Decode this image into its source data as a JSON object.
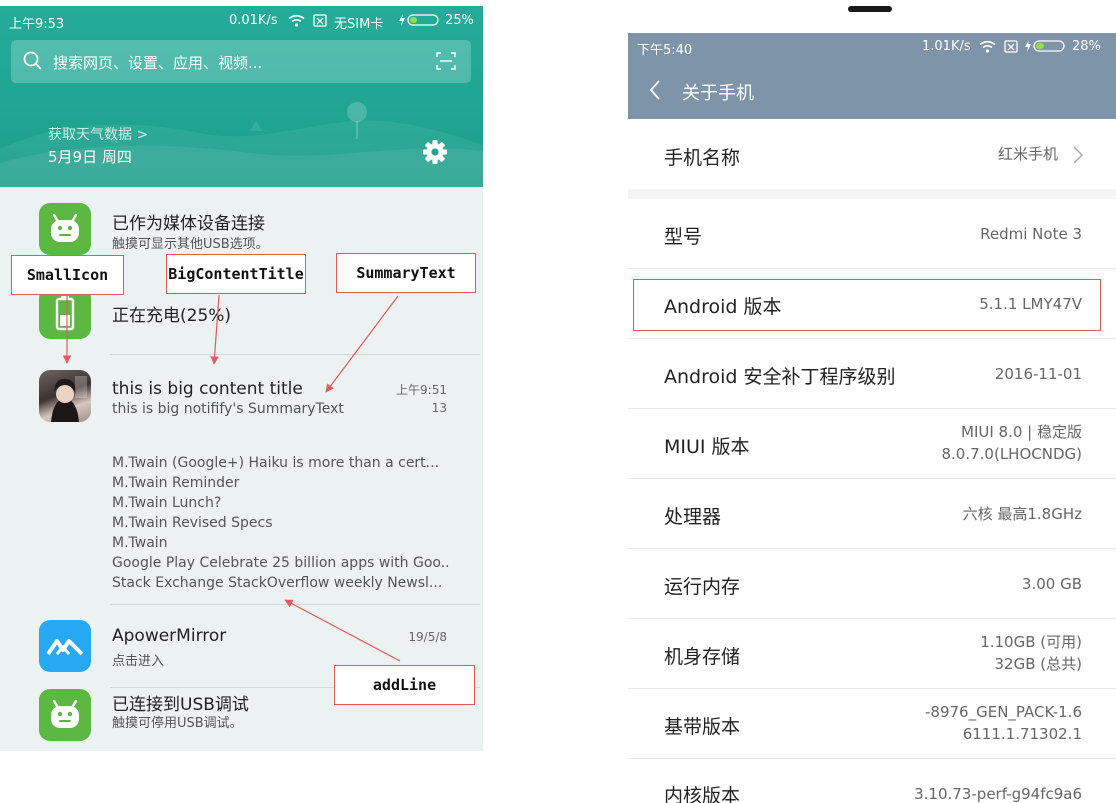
{
  "left_phone": {
    "status_bar": {
      "time": "上午9:53",
      "speed": "0.01K/s",
      "sim": "无SIM卡",
      "battery": "25%"
    },
    "search": {
      "placeholder": "搜索网页、设置、应用、视频..."
    },
    "weather": {
      "link": "获取天气数据 >",
      "date": "5月9日 周四"
    },
    "notifications": [
      {
        "title": "已作为媒体设备连接",
        "subtitle": "触摸可显示其他USB选项。",
        "icon": "android-robot-icon"
      },
      {
        "title": "正在充电(25%)",
        "icon": "battery-icon"
      },
      {
        "title": "this is big content title",
        "subtitle": "this is big notifify's SummaryText",
        "time": "上午9:51",
        "count": "13",
        "icon": "avatar-photo",
        "lines": [
          "M.Twain (Google+) Haiku is more than a cert...",
          "M.Twain Reminder",
          "M.Twain Lunch?",
          "M.Twain Revised Specs",
          "M.Twain",
          "Google Play Celebrate 25 billion apps with Goo..",
          "Stack Exchange StackOverflow weekly Newsl..."
        ]
      },
      {
        "title": "ApowerMirror",
        "subtitle": "点击进入",
        "time": "19/5/8",
        "icon": "apowermirror-icon"
      },
      {
        "title": "已连接到USB调试",
        "subtitle": "触摸可停用USB调试。",
        "icon": "android-robot-icon"
      }
    ],
    "annotations": [
      "SmallIcon",
      "BigContentTitle",
      "SummaryText",
      "addLine"
    ]
  },
  "right_phone": {
    "status_bar": {
      "time": "下午5:40",
      "speed": "1.01K/s",
      "battery": "28%"
    },
    "header": {
      "title": "关于手机"
    },
    "rows": [
      {
        "label": "手机名称",
        "value": "红米手机"
      },
      {
        "label": "型号",
        "value": "Redmi Note 3"
      },
      {
        "label": "Android 版本",
        "value": "5.1.1 LMY47V"
      },
      {
        "label": "Android 安全补丁程序级别",
        "value": "2016-11-01"
      },
      {
        "label": "MIUI 版本",
        "value": "MIUI 8.0 | 稳定版",
        "value2": "8.0.7.0(LHOCNDG)"
      },
      {
        "label": "处理器",
        "value": "六核 最高1.8GHz"
      },
      {
        "label": "运行内存",
        "value": "3.00 GB"
      },
      {
        "label": "机身存储",
        "value": "1.10GB (可用)",
        "value2": "32GB (总共)"
      },
      {
        "label": "基带版本",
        "value": "-8976_GEN_PACK-1.6",
        "value2": "6111.1.71302.1"
      },
      {
        "label": "内核版本",
        "value": "3.10.73-perf-g94fc9a6"
      }
    ]
  },
  "colors": {
    "teal": "#1fa592",
    "annotation_red": "#e5595c",
    "miui_header": "#7e94a9",
    "android_green": "#5db843",
    "apower_blue": "#27a8f2"
  }
}
